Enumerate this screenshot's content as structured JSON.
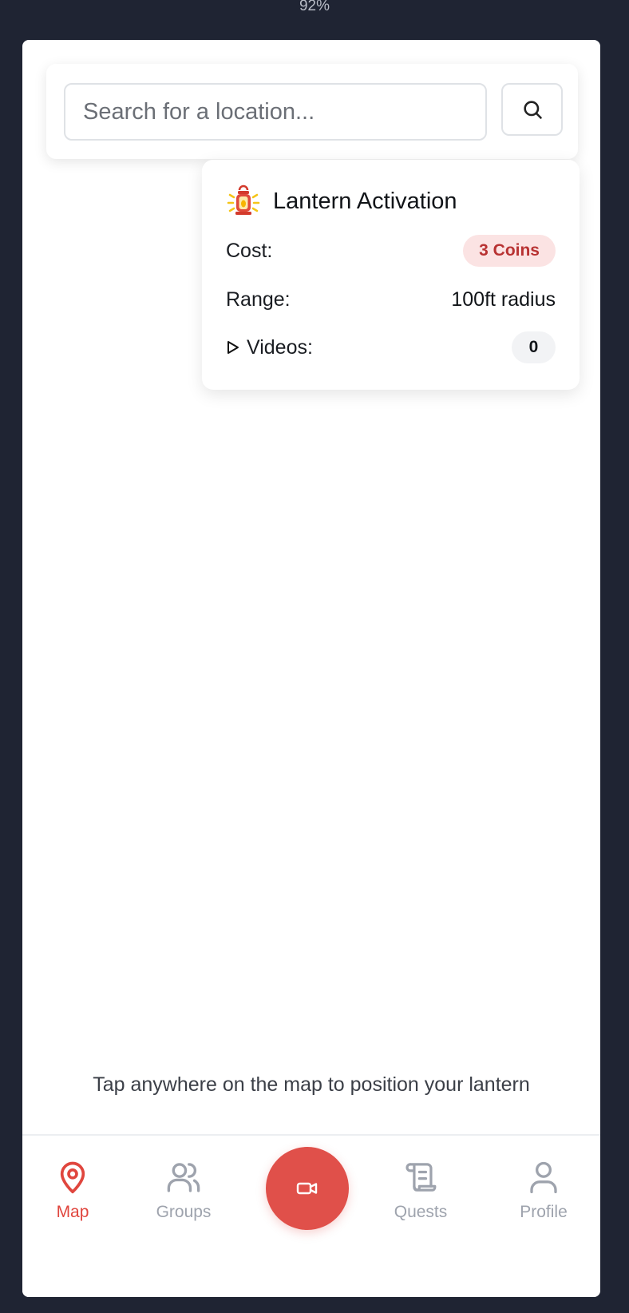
{
  "status": {
    "battery": "92%"
  },
  "search": {
    "placeholder": "Search for a location..."
  },
  "lantern_card": {
    "title": "Lantern Activation",
    "cost_label": "Cost:",
    "cost_value": "3 Coins",
    "range_label": "Range:",
    "range_value": "100ft radius",
    "videos_label": "Videos:",
    "videos_count": "0"
  },
  "map": {
    "hint": "Tap anywhere on the map to position your lantern"
  },
  "nav": {
    "items": [
      {
        "label": "Map",
        "icon": "map-pin-icon",
        "active": true
      },
      {
        "label": "Groups",
        "icon": "users-icon",
        "active": false
      },
      {
        "label": "Quests",
        "icon": "scroll-icon",
        "active": false
      },
      {
        "label": "Profile",
        "icon": "user-icon",
        "active": false
      }
    ],
    "record_icon": "video-camera-icon"
  },
  "colors": {
    "accent": "#e0463e",
    "cost_badge_bg": "#fbe3e3",
    "cost_badge_text": "#b83232",
    "inactive_nav": "#9ea3ad",
    "page_background": "#1f2433"
  }
}
